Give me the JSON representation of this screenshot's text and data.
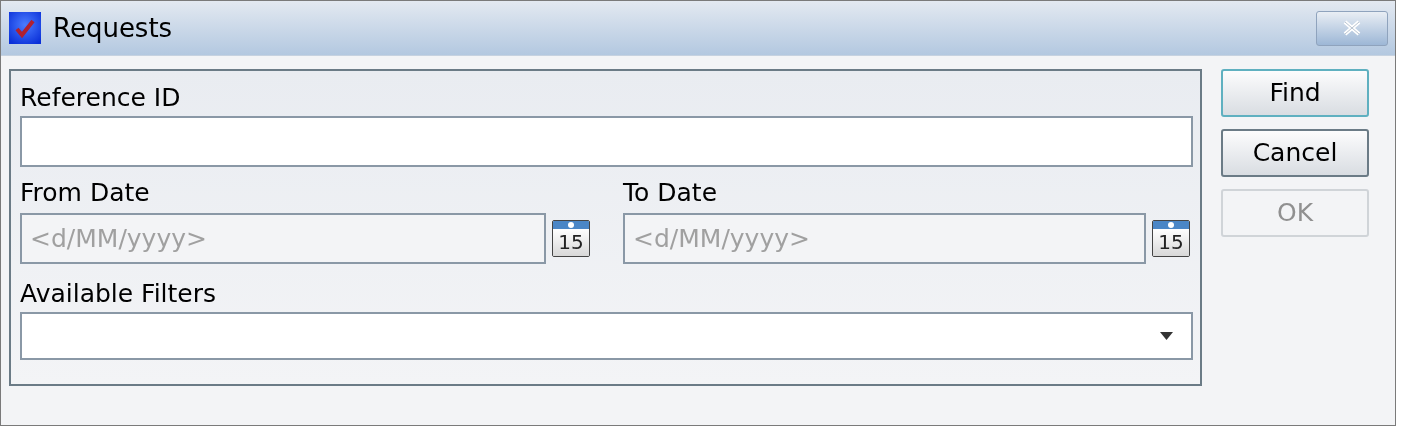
{
  "window": {
    "title": "Requests"
  },
  "fields": {
    "reference_id": {
      "label": "Reference ID"
    },
    "from_date": {
      "label": "From Date",
      "placeholder": "<d/MM/yyyy>",
      "calendar_day": "15"
    },
    "to_date": {
      "label": "To Date",
      "placeholder": "<d/MM/yyyy>",
      "calendar_day": "15"
    },
    "available_filters": {
      "label": "Available Filters"
    }
  },
  "buttons": [
    {
      "label": "Find",
      "focused": true,
      "disabled": false
    },
    {
      "label": "Cancel",
      "focused": false,
      "disabled": false
    },
    {
      "label": "OK",
      "focused": false,
      "disabled": true
    }
  ]
}
